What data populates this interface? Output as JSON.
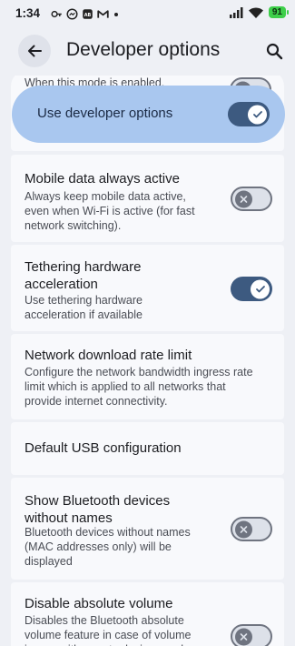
{
  "status_bar": {
    "time": "1:34",
    "battery": "91"
  },
  "header": {
    "title": "Developer options"
  },
  "main": {
    "partial_text": "When this mode is enabled.",
    "master": {
      "label": "Use developer options",
      "on": true
    },
    "settings": [
      {
        "title": "Mobile data always active",
        "description": "Always keep mobile data active, even when Wi-Fi is active (for fast network switching).",
        "toggle": "off"
      },
      {
        "title": "Tethering hardware acceleration",
        "description": "Use tethering hardware acceleration if available",
        "toggle": "on"
      },
      {
        "title": "Network download rate limit",
        "description": "Configure the network bandwidth ingress rate limit which is applied to all networks that provide internet connectivity."
      },
      {
        "title": "Default USB configuration"
      },
      {
        "title": "Show Bluetooth devices without names",
        "description": "Bluetooth devices without names (MAC addresses only) will be displayed",
        "toggle": "off"
      },
      {
        "title": "Disable absolute volume",
        "description": "Disables the Bluetooth absolute volume feature in case of volume issues with remote devices such",
        "toggle": "off"
      }
    ]
  },
  "colors": {
    "background": "#eef0f5",
    "card": "#f8f9fc",
    "accent": "#3d5a80",
    "master_highlight": "#a9c7ef",
    "battery": "#3ecf4a"
  }
}
